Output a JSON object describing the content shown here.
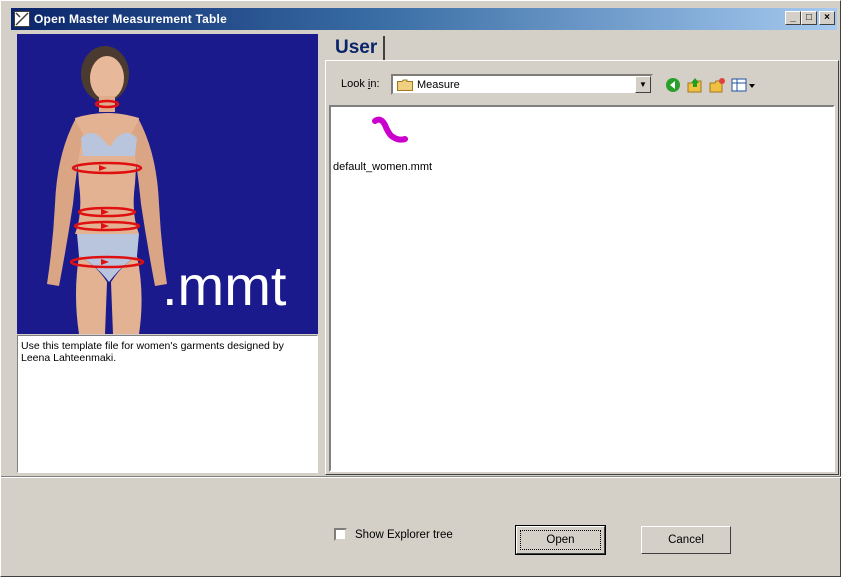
{
  "window": {
    "title": "Open Master Measurement Table",
    "minimize": "_",
    "maximize": "□",
    "close": "×"
  },
  "preview": {
    "extension_label": ".mmt",
    "description": "Use this template file for women's garments designed by Leena Lahteenmaki.",
    "background": "#1a1a8c"
  },
  "tab": {
    "label": "User"
  },
  "browser": {
    "look_in_label": "Look in:",
    "look_in_value": "Measure",
    "toolbar_icons": [
      "back-icon",
      "up-folder-icon",
      "new-folder-icon",
      "view-menu-icon"
    ],
    "files": [
      {
        "name": "default_women.mmt",
        "icon": "measurement-file-icon"
      }
    ]
  },
  "footer": {
    "show_explorer_label": "Show Explorer tree",
    "show_explorer_checked": false,
    "open_label": "Open",
    "cancel_label": "Cancel"
  },
  "colors": {
    "accent": "#0a246a",
    "file_icon": "#cc00cc"
  }
}
